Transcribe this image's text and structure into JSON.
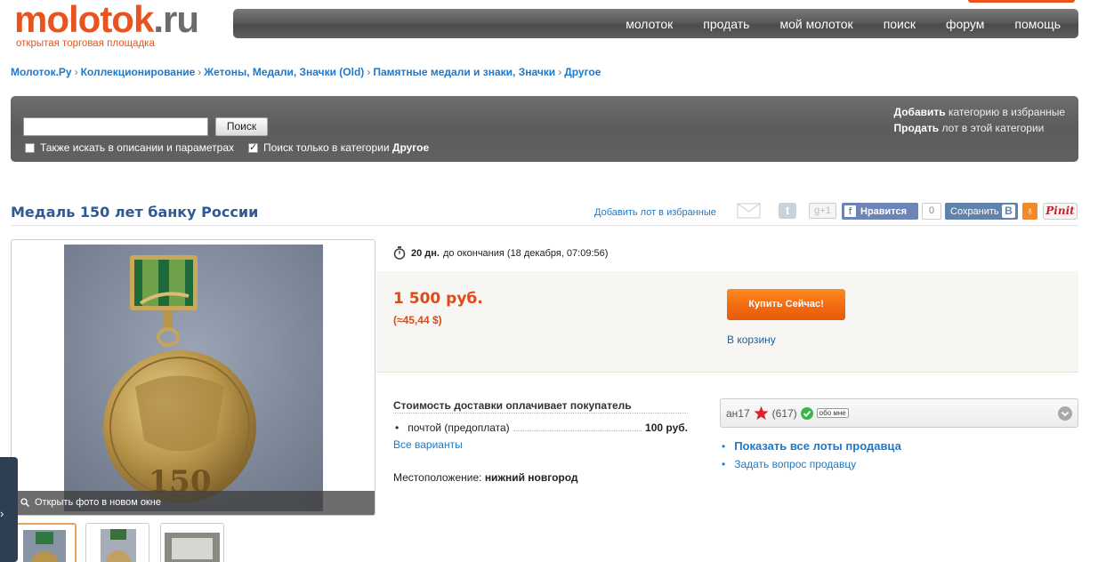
{
  "logo": {
    "main": "molotok",
    "suffix": ".ru",
    "tagline": "открытая торговая площадка"
  },
  "nav": [
    "молоток",
    "продать",
    "мой молоток",
    "поиск",
    "форум",
    "помощь"
  ],
  "breadcrumb": [
    "Молоток.Ру",
    "Коллекционирование",
    "Жетоны, Медали, Значки (Old)",
    "Памятные медали и знаки, Значки",
    "Другое"
  ],
  "search": {
    "button": "Поиск",
    "value": "",
    "also_desc": "Также искать в описании и параметрах",
    "only_cat_prefix": "Поиск только в категории",
    "only_cat_name": "Другое",
    "add_fav_bold": "Добавить",
    "add_fav_rest": "категорию в избранные",
    "sell_bold": "Продать",
    "sell_rest": "лот в этой категории"
  },
  "lot": {
    "title": "Медаль 150 лет банку России",
    "add_to_fav": "Добавить лот в избранные",
    "open_photo": "Открыть фото в новом окне",
    "time_left_bold": "20 дн.",
    "time_left_rest": "до окончания (18 декабря, 07:09:56)",
    "price": "1 500 руб.",
    "price_usd": "(≈45,44 $)",
    "buy_now": "Купить Сейчас!",
    "to_cart": "В корзину",
    "shipping_header": "Стоимость доставки оплачивает покупатель",
    "shipping_method": "почтой (предоплата)",
    "shipping_cost": "100 руб.",
    "all_variants": "Все варианты",
    "location_label": "Местоположение:",
    "location_value": "нижний новгород"
  },
  "social": {
    "gplus": "g+1",
    "fb_like": "Нравится",
    "fb_count": "0",
    "vk_save": "Сохранить",
    "vk_letter": "B",
    "pinit": "Pinit"
  },
  "seller": {
    "name": "ан17",
    "rating": "(617)",
    "about_me": "обо мне",
    "show_all": "Показать все лоты продавца",
    "ask": "Задать вопрос продавцу"
  },
  "colors": {
    "accent": "#e8531e",
    "link": "#1f78c8",
    "price": "#e04a14",
    "title": "#2f5a93"
  }
}
